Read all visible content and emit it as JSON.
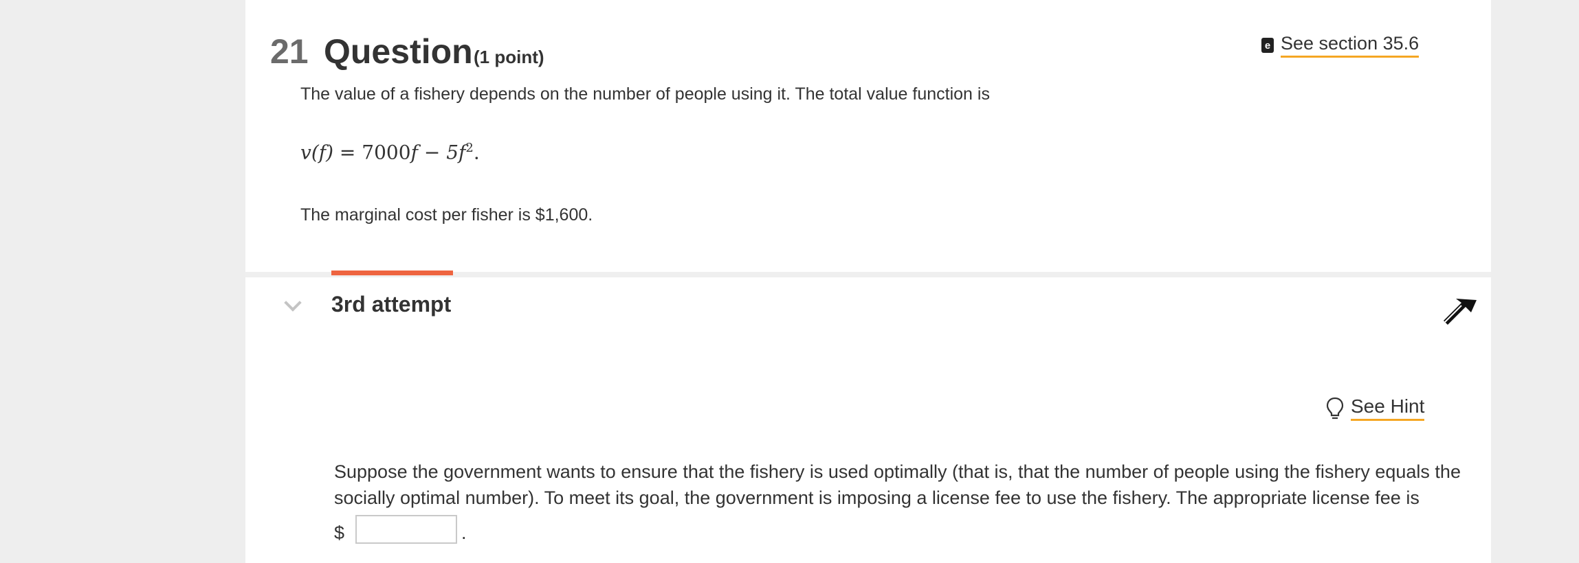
{
  "question": {
    "number": "21",
    "title": "Question",
    "points": "(1 point)",
    "section_link": "See section 35.6",
    "ebook_icon": "e",
    "intro": "The value of a fishery depends on the number of people using it. The total value function is",
    "formula": {
      "lhs": "v(f) = ",
      "coef1": "7000",
      "term1": "f − 5",
      "term2": "f",
      "exp": "2",
      "end": "."
    },
    "marginal_cost": "The marginal cost per fisher is $1,600."
  },
  "attempt": {
    "label": "3rd attempt",
    "hint_label": "See Hint",
    "body": "Suppose the government wants to ensure that the fishery is used optimally (that is, that the number of people using the fishery equals the socially optimal number). To meet its goal, the government is imposing a license fee to use the fishery. The appropriate license fee is",
    "currency": "$",
    "answer_value": "",
    "trailing": "."
  },
  "colors": {
    "accent_orange": "#ee6440",
    "link_underline": "#f5a623"
  }
}
